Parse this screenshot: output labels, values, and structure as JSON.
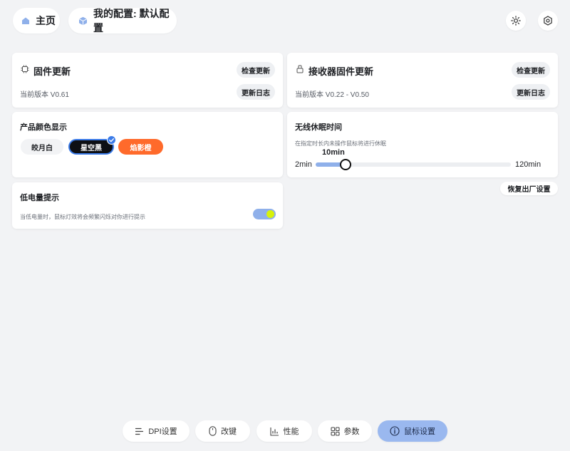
{
  "header": {
    "home_label": "主页",
    "config_label": "我的配置: 默认配置",
    "icons": {
      "home": "home-icon",
      "config": "cube-icon",
      "theme": "sun-icon",
      "settings": "hex-gear-icon"
    }
  },
  "firmware": {
    "title": "固件更新",
    "version": "当前版本 V0.61",
    "check_label": "检查更新",
    "log_label": "更新日志"
  },
  "receiver_firmware": {
    "title": "接收器固件更新",
    "version": "当前版本 V0.22 - V0.50",
    "check_label": "检查更新",
    "log_label": "更新日志"
  },
  "color_display": {
    "title": "产品颜色显示",
    "options": [
      {
        "label": "皎月白",
        "selected": false,
        "bg": "#f2f3f5",
        "fg": "#1d1f23"
      },
      {
        "label": "星空黑",
        "selected": true,
        "bg": "#0d0f14",
        "fg": "#ffffff"
      },
      {
        "label": "焰影橙",
        "selected": false,
        "bg": "#ff6a2b",
        "fg": "#ffffff"
      }
    ]
  },
  "sleep": {
    "title": "无线休眠时间",
    "hint": "在指定时长内未操作鼠标将进行休眠",
    "value_label": "10min",
    "min_label": "2min",
    "max_label": "120min",
    "value": 10,
    "min": 2,
    "max": 120
  },
  "factory_reset_label": "恢复出厂设置",
  "low_battery": {
    "title": "低电量提示",
    "hint": "当低电量时，鼠标灯效将会频繁闪烁对你进行提示",
    "enabled": true
  },
  "bottom_nav": [
    {
      "label": "DPI设置",
      "icon": "dpi-lines-icon",
      "active": false
    },
    {
      "label": "改键",
      "icon": "mouse-icon",
      "active": false
    },
    {
      "label": "性能",
      "icon": "chart-icon",
      "active": false
    },
    {
      "label": "参数",
      "icon": "grid-icon",
      "active": false
    },
    {
      "label": "鼠标设置",
      "icon": "info-icon",
      "active": true
    }
  ],
  "colors": {
    "accent": "#9ab8ef",
    "toggle_track": "#8fb0ea",
    "toggle_knob": "#d7f20a",
    "slider_fill": "#8fb0ea"
  }
}
